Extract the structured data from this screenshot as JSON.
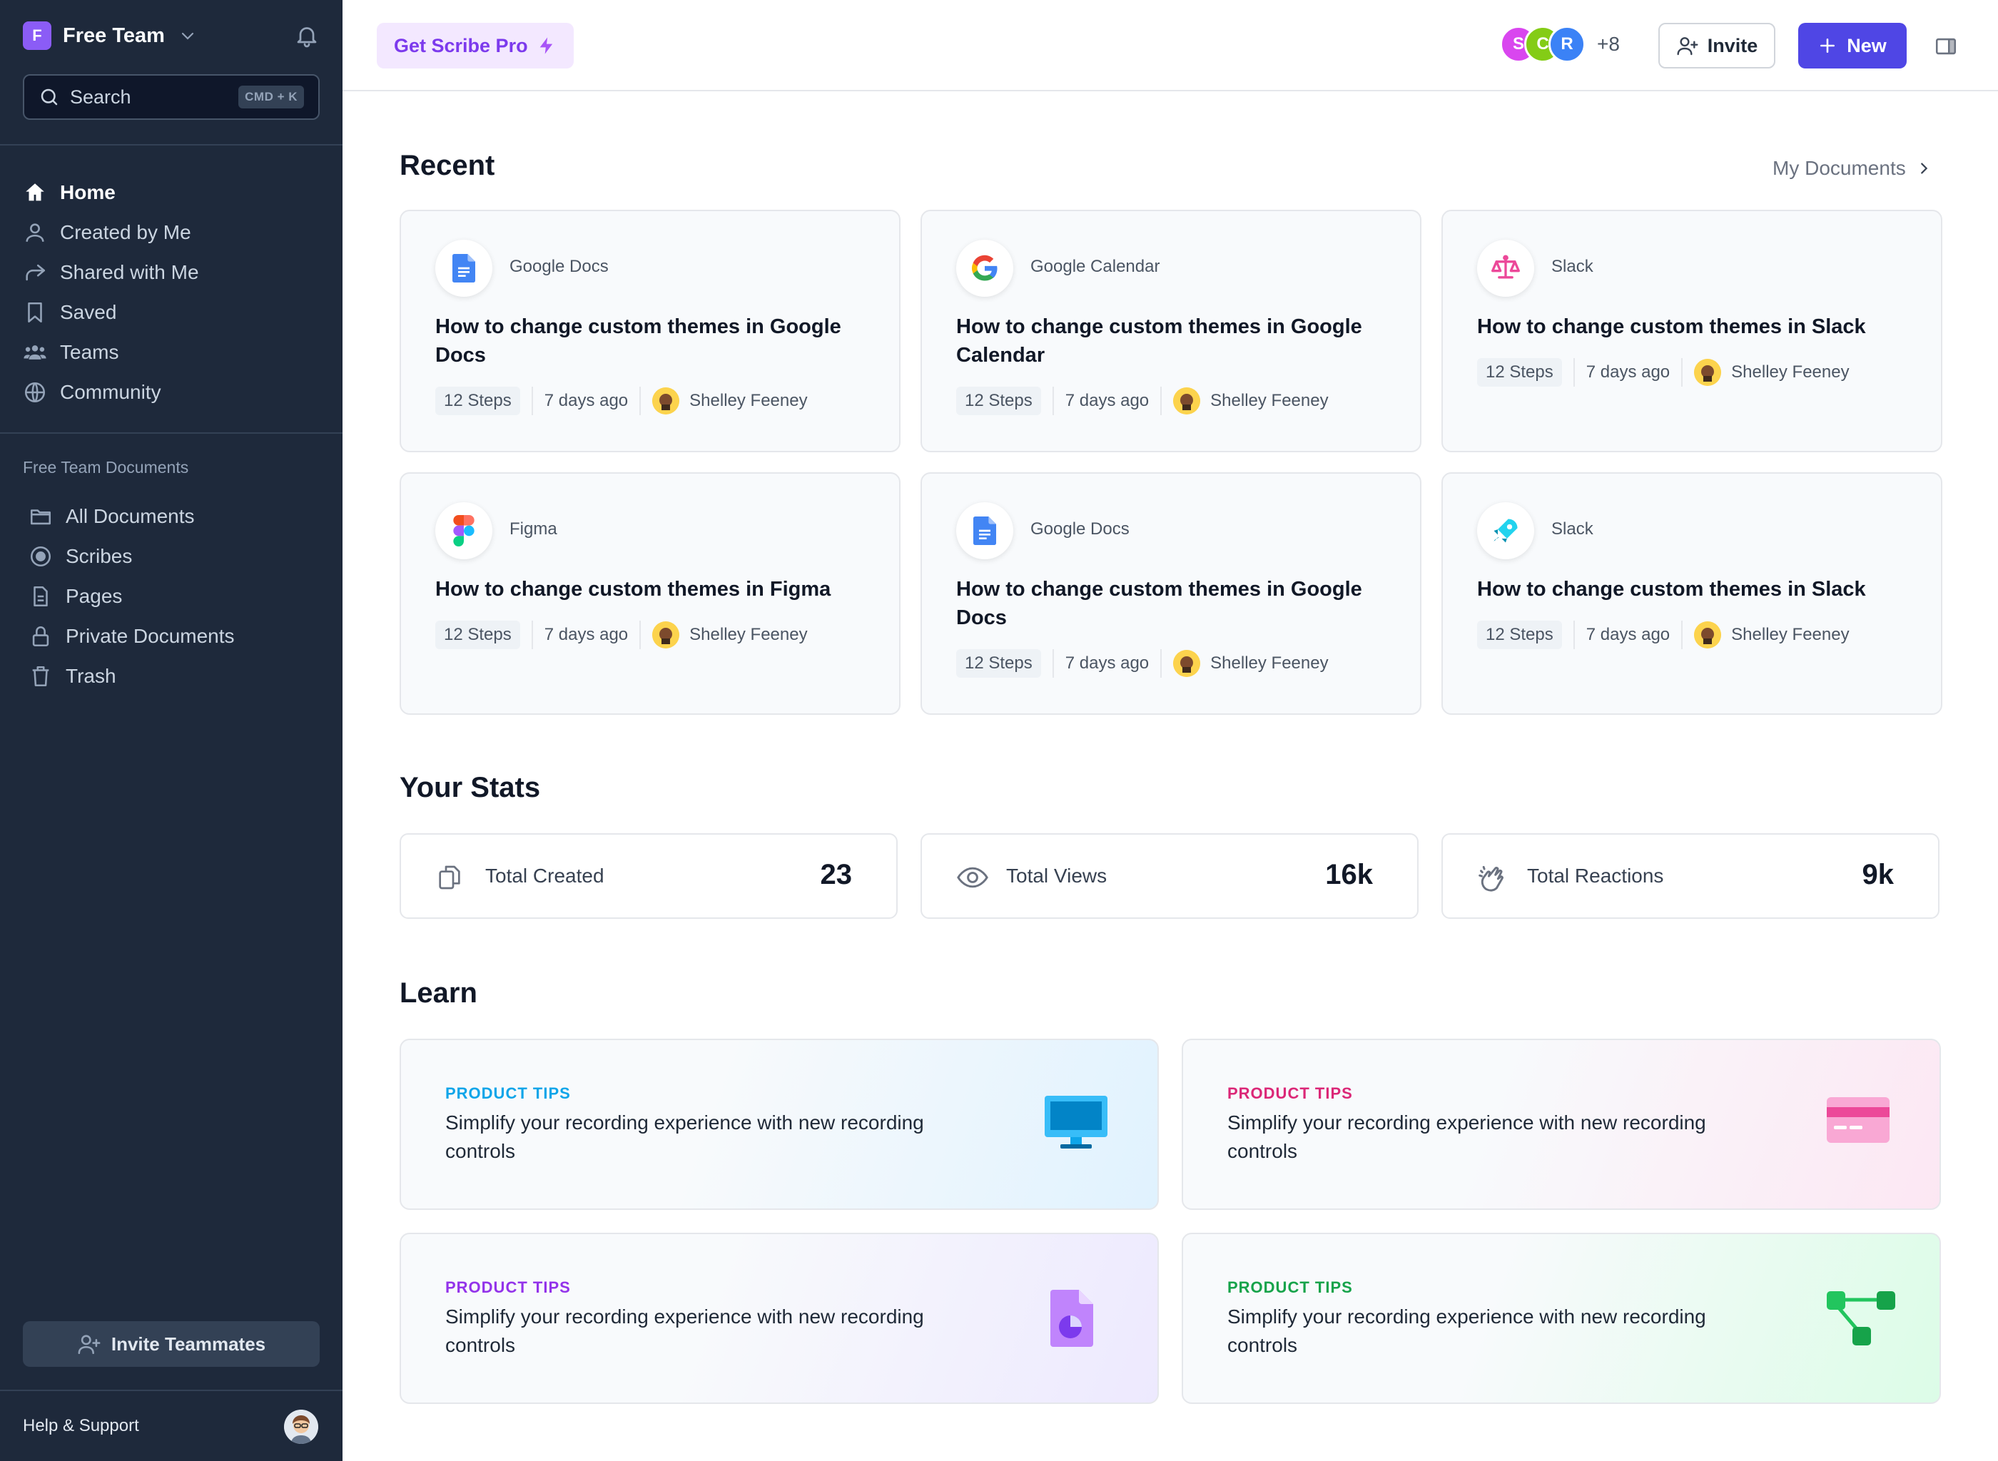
{
  "sidebar": {
    "team_initial": "F",
    "team_name": "Free Team",
    "search_placeholder": "Search",
    "search_shortcut": "CMD + K",
    "nav": [
      {
        "label": "Home",
        "icon": "home-icon"
      },
      {
        "label": "Created by Me",
        "icon": "user-icon"
      },
      {
        "label": "Shared with Me",
        "icon": "share-icon"
      },
      {
        "label": "Saved",
        "icon": "bookmark-icon"
      },
      {
        "label": "Teams",
        "icon": "users-icon"
      },
      {
        "label": "Community",
        "icon": "globe-icon"
      }
    ],
    "section_label": "Free Team Documents",
    "docs_nav": [
      {
        "label": "All Documents",
        "icon": "folder-icon"
      },
      {
        "label": "Scribes",
        "icon": "record-icon"
      },
      {
        "label": "Pages",
        "icon": "page-icon"
      },
      {
        "label": "Private Documents",
        "icon": "lock-icon"
      },
      {
        "label": "Trash",
        "icon": "trash-icon"
      }
    ],
    "invite_label": "Invite Teammates",
    "help_label": "Help & Support"
  },
  "topbar": {
    "pro_label": "Get Scribe Pro",
    "avatars": [
      {
        "initial": "S",
        "color": "#d946ef"
      },
      {
        "initial": "C",
        "color": "#84cc16"
      },
      {
        "initial": "R",
        "color": "#3b82f6"
      }
    ],
    "avatars_more": "+8",
    "invite_label": "Invite",
    "new_label": "New"
  },
  "recent": {
    "heading": "Recent",
    "link_label": "My Documents",
    "cards": [
      {
        "app": "Google Docs",
        "title": "How to change custom themes in Google Docs",
        "steps": "12 Steps",
        "time": "7 days ago",
        "author": "Shelley Feeney",
        "icon": "google-docs-icon"
      },
      {
        "app": "Google Calendar",
        "title": "How to change custom themes in Google Calendar",
        "steps": "12 Steps",
        "time": "7 days ago",
        "author": "Shelley Feeney",
        "icon": "google-icon"
      },
      {
        "app": "Slack",
        "title": "How to change custom themes in Slack",
        "steps": "12 Steps",
        "time": "7 days ago",
        "author": "Shelley Feeney",
        "icon": "scale-icon"
      },
      {
        "app": "Figma",
        "title": "How to change custom themes in Figma",
        "steps": "12 Steps",
        "time": "7 days ago",
        "author": "Shelley Feeney",
        "icon": "figma-icon"
      },
      {
        "app": "Google Docs",
        "title": "How to change custom themes in Google Docs",
        "steps": "12 Steps",
        "time": "7 days ago",
        "author": "Shelley Feeney",
        "icon": "google-docs-icon"
      },
      {
        "app": "Slack",
        "title": "How to change custom themes in Slack",
        "steps": "12 Steps",
        "time": "7 days ago",
        "author": "Shelley Feeney",
        "icon": "rocket-icon"
      }
    ]
  },
  "stats": {
    "heading": "Your Stats",
    "items": [
      {
        "label": "Total Created",
        "value": "23",
        "icon": "copy-icon"
      },
      {
        "label": "Total Views",
        "value": "16k",
        "icon": "eye-icon"
      },
      {
        "label": "Total Reactions",
        "value": "9k",
        "icon": "clap-icon"
      }
    ]
  },
  "learn": {
    "heading": "Learn",
    "items": [
      {
        "tag": "PRODUCT TIPS",
        "text": "Simplify your recording experience with new recording controls",
        "accent": "#0ea5e9",
        "icon": "monitor-icon"
      },
      {
        "tag": "PRODUCT TIPS",
        "text": "Simplify your recording experience with new recording controls",
        "accent": "#db2777",
        "icon": "credit-card-icon"
      },
      {
        "tag": "PRODUCT TIPS",
        "text": "Simplify your recording experience with new recording controls",
        "accent": "#9333ea",
        "icon": "pie-document-icon"
      },
      {
        "tag": "PRODUCT TIPS",
        "text": "Simplify your recording experience with new recording controls",
        "accent": "#16a34a",
        "icon": "flow-diagram-icon"
      }
    ]
  }
}
